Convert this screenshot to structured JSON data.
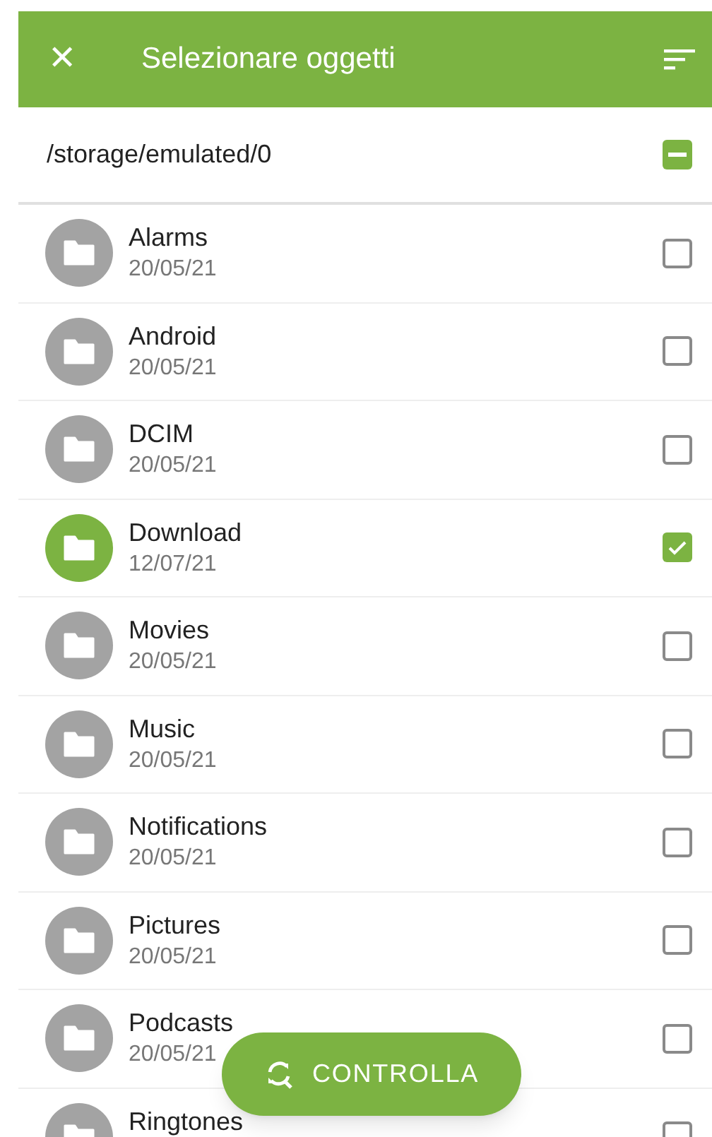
{
  "app_bar": {
    "close_icon": "✕",
    "title": "Selezionare oggetti"
  },
  "path": {
    "text": "/storage/emulated/0",
    "indeterminate": true
  },
  "items": [
    {
      "name": "Alarms",
      "date": "20/05/21",
      "checked": false
    },
    {
      "name": "Android",
      "date": "20/05/21",
      "checked": false
    },
    {
      "name": "DCIM",
      "date": "20/05/21",
      "checked": false
    },
    {
      "name": "Download",
      "date": "12/07/21",
      "checked": true
    },
    {
      "name": "Movies",
      "date": "20/05/21",
      "checked": false
    },
    {
      "name": "Music",
      "date": "20/05/21",
      "checked": false
    },
    {
      "name": "Notifications",
      "date": "20/05/21",
      "checked": false
    },
    {
      "name": "Pictures",
      "date": "20/05/21",
      "checked": false
    },
    {
      "name": "Podcasts",
      "date": "20/05/21",
      "checked": false
    },
    {
      "name": "Ringtones",
      "checked": false
    }
  ],
  "fab": {
    "label": "CONTROLLA"
  }
}
